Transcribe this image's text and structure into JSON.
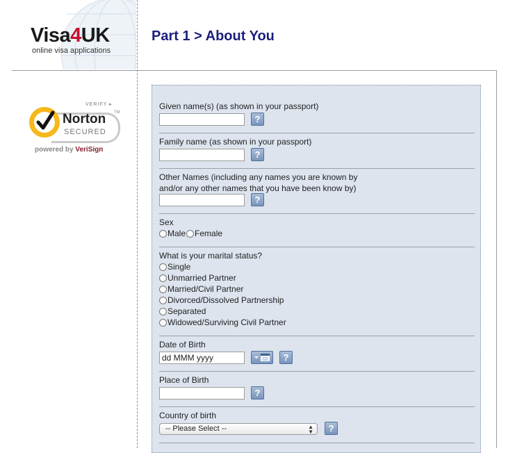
{
  "header": {
    "logo_prefix": "Visa",
    "logo_accent": "4",
    "logo_suffix": "UK",
    "logo_tagline": "online visa applications",
    "page_title": "Part 1 > About You"
  },
  "badge": {
    "verify": "VERIFY",
    "trademark": "TM",
    "name": "Norton",
    "secured": "SECURED",
    "powered_by": "powered by ",
    "provider": "VeriSign",
    "colors": {
      "seal": "#f6b81a",
      "provider": "#8a1d2e"
    }
  },
  "form": {
    "given_name": {
      "label": "Given name(s) (as shown in your passport)",
      "value": ""
    },
    "family_name": {
      "label": "Family name (as shown in your passport)",
      "value": ""
    },
    "other_names": {
      "label_line1": "Other Names (including any names you are known by",
      "label_line2": "and/or any other names that you have been know by)",
      "value": ""
    },
    "sex": {
      "label": "Sex",
      "options": [
        "Male",
        "Female"
      ]
    },
    "marital_status": {
      "label": "What is your marital status?",
      "options": [
        "Single",
        "Unmarried Partner",
        "Married/Civil Partner",
        "Divorced/Dissolved Partnership",
        "Separated",
        "Widowed/Surviving Civil Partner"
      ]
    },
    "date_of_birth": {
      "label": "Date of Birth",
      "value": "dd MMM yyyy"
    },
    "place_of_birth": {
      "label": "Place of Birth",
      "value": ""
    },
    "country_of_birth": {
      "label": "Country of birth",
      "selected": "-- Please Select --"
    },
    "help_glyph": "?",
    "calendar_icon": "calendar-icon"
  },
  "colors": {
    "title": "#1b1f7a",
    "panel": "#dde4ee",
    "accent_red": "#c8102e"
  }
}
